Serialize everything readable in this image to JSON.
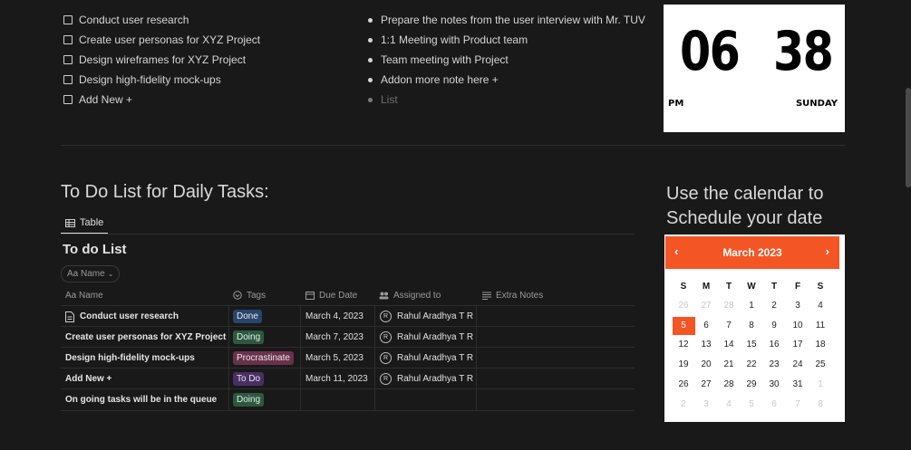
{
  "checklist": [
    {
      "label": "Conduct user research",
      "checked": false
    },
    {
      "label": "Create user personas for XYZ Project",
      "checked": false
    },
    {
      "label": "Design wireframes for XYZ Project",
      "checked": false
    },
    {
      "label": "Design high-fidelity mock-ups",
      "checked": false
    },
    {
      "label": "Add New +",
      "checked": false
    }
  ],
  "notes": {
    "items": [
      "Prepare the notes from the user interview with Mr. TUV",
      "1:1 Meeting with Product team",
      "Team meeting with Project",
      "Addon more note here +"
    ],
    "placeholder": "List"
  },
  "clock": {
    "hours": "06",
    "minutes": "38",
    "meridiem": "PM",
    "weekday": "SUNDAY"
  },
  "todo": {
    "heading": "To Do List for Daily Tasks:",
    "view_tab": "Table",
    "title": "To do List",
    "filter_label": "Aa Name",
    "columns": {
      "name": "Aa Name",
      "tags": "Tags",
      "due": "Due Date",
      "assigned": "Assigned to",
      "notes": "Extra Notes"
    },
    "rows": [
      {
        "name": "Conduct user research",
        "tag": "Done",
        "tag_color": "#28456c",
        "due": "March 4, 2023",
        "assigned": "Rahul Aradhya T R",
        "page_icon": true
      },
      {
        "name": "Create user personas for XYZ Project",
        "tag": "Doing",
        "tag_color": "#2b593f",
        "due": "March 7, 2023",
        "assigned": "Rahul Aradhya T R",
        "page_icon": false
      },
      {
        "name": "Design high-fidelity mock-ups",
        "tag": "Procrastinate",
        "tag_color": "#69314c",
        "due": "March 5, 2023",
        "assigned": "Rahul Aradhya T R",
        "page_icon": false
      },
      {
        "name": "Add New +",
        "tag": "To Do",
        "tag_color": "#492f64",
        "due": "March 11, 2023",
        "assigned": "Rahul Aradhya T R",
        "page_icon": false
      },
      {
        "name": "On going tasks will be in the queue",
        "tag": "Doing",
        "tag_color": "#2b593f",
        "due": "",
        "assigned": "",
        "page_icon": false
      }
    ],
    "avatar_initial": "R"
  },
  "calendar": {
    "heading": "Use the calendar to Schedule your date",
    "month_label": "March 2023",
    "prev": "‹",
    "next": "›",
    "weekdays": [
      "S",
      "M",
      "T",
      "W",
      "T",
      "F",
      "S"
    ],
    "weeks": [
      [
        {
          "d": "26",
          "m": 1
        },
        {
          "d": "27",
          "m": 1
        },
        {
          "d": "28",
          "m": 1
        },
        {
          "d": "1"
        },
        {
          "d": "2"
        },
        {
          "d": "3"
        },
        {
          "d": "4"
        }
      ],
      [
        {
          "d": "5",
          "t": 1
        },
        {
          "d": "6"
        },
        {
          "d": "7"
        },
        {
          "d": "8"
        },
        {
          "d": "9"
        },
        {
          "d": "10"
        },
        {
          "d": "11"
        }
      ],
      [
        {
          "d": "12"
        },
        {
          "d": "13"
        },
        {
          "d": "14"
        },
        {
          "d": "15"
        },
        {
          "d": "16"
        },
        {
          "d": "17"
        },
        {
          "d": "18"
        }
      ],
      [
        {
          "d": "19"
        },
        {
          "d": "20"
        },
        {
          "d": "21"
        },
        {
          "d": "22"
        },
        {
          "d": "23"
        },
        {
          "d": "24"
        },
        {
          "d": "25"
        }
      ],
      [
        {
          "d": "26"
        },
        {
          "d": "27"
        },
        {
          "d": "28"
        },
        {
          "d": "29"
        },
        {
          "d": "30"
        },
        {
          "d": "31"
        },
        {
          "d": "1",
          "m": 1
        }
      ],
      [
        {
          "d": "2",
          "m": 1
        },
        {
          "d": "3",
          "m": 1
        },
        {
          "d": "4",
          "m": 1
        },
        {
          "d": "5",
          "m": 1
        },
        {
          "d": "6",
          "m": 1
        },
        {
          "d": "7",
          "m": 1
        },
        {
          "d": "8",
          "m": 1
        }
      ]
    ],
    "accent": "#f35525"
  }
}
